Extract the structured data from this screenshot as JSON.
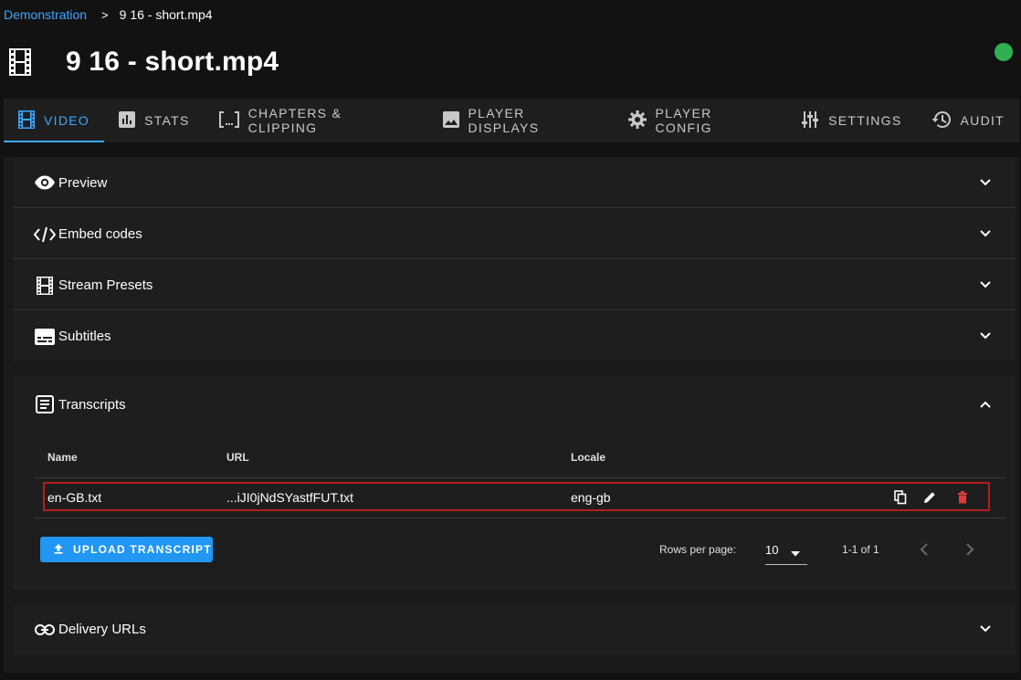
{
  "breadcrumb": {
    "parent": "Demonstration",
    "separator": ">",
    "current": "9 16 - short.mp4"
  },
  "page": {
    "title": "9 16 - short.mp4",
    "icon": "film-icon",
    "status_color": "#2eb050"
  },
  "tabs": [
    {
      "label": "VIDEO",
      "icon": "video-film-icon",
      "active": true
    },
    {
      "label": "STATS",
      "icon": "bar-chart-icon",
      "active": false
    },
    {
      "label": "CHAPTERS & CLIPPING",
      "icon": "brackets-icon",
      "active": false
    },
    {
      "label": "PLAYER DISPLAYS",
      "icon": "image-icon",
      "active": false
    },
    {
      "label": "PLAYER CONFIG",
      "icon": "gear-icon",
      "active": false
    },
    {
      "label": "SETTINGS",
      "icon": "sliders-icon",
      "active": false
    },
    {
      "label": "AUDIT",
      "icon": "history-icon",
      "active": false
    }
  ],
  "sections": {
    "preview": {
      "label": "Preview",
      "icon": "eye-icon"
    },
    "embed": {
      "label": "Embed codes",
      "icon": "code-icon"
    },
    "stream": {
      "label": "Stream Presets",
      "icon": "film-icon"
    },
    "subtitles": {
      "label": "Subtitles",
      "icon": "subtitles-icon"
    },
    "transcripts": {
      "label": "Transcripts",
      "icon": "document-icon"
    },
    "delivery": {
      "label": "Delivery URLs",
      "icon": "link-icon"
    }
  },
  "transcripts_table": {
    "headers": {
      "name": "Name",
      "url": "URL",
      "locale": "Locale"
    },
    "rows": [
      {
        "name": "en-GB.txt",
        "url": "...iJI0jNdSYastfFUT.txt",
        "locale": "eng-gb"
      }
    ],
    "upload_label": "UPLOAD TRANSCRIPT",
    "rows_per_page_label": "Rows per page:",
    "rows_per_page_value": "10",
    "range_label": "1-1 of 1"
  },
  "colors": {
    "accent": "#3ea6ff",
    "button": "#2196f3",
    "delete": "#e53935",
    "selected_border": "#b71c1c"
  }
}
